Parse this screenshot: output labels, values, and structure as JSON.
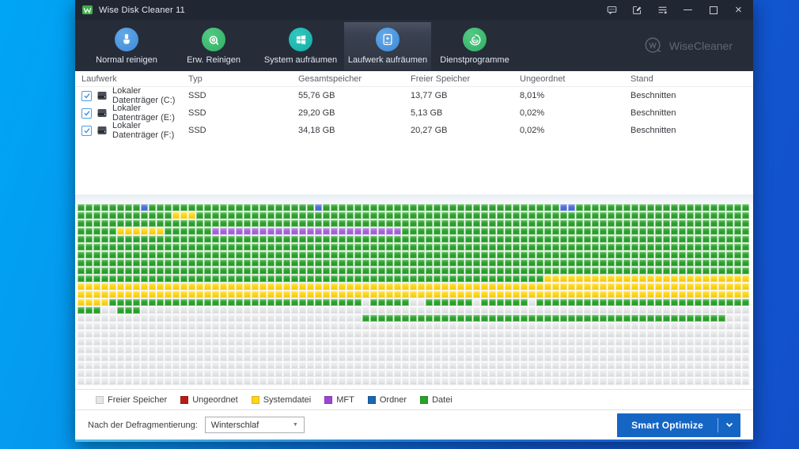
{
  "titlebar": {
    "title": "Wise Disk Cleaner 11"
  },
  "nav": {
    "brand": "WiseCleaner",
    "tabs": [
      {
        "label": "Normal reinigen",
        "selected": false
      },
      {
        "label": "Erw. Reinigen",
        "selected": false
      },
      {
        "label": "System aufräumen",
        "selected": false
      },
      {
        "label": "Laufwerk aufräumen",
        "selected": true
      },
      {
        "label": "Dienstprogramme",
        "selected": false
      }
    ]
  },
  "table": {
    "columns": [
      "Laufwerk",
      "Typ",
      "Gesamtspeicher",
      "Freier Speicher",
      "Ungeordnet",
      "Stand"
    ],
    "rows": [
      {
        "checked": true,
        "name": "Lokaler Datenträger (C:)",
        "typ": "SSD",
        "gesamt": "55,76 GB",
        "frei": "13,77 GB",
        "ungeordnet": "8,01%",
        "stand": "Beschnitten"
      },
      {
        "checked": true,
        "name": "Lokaler Datenträger (E:)",
        "typ": "SSD",
        "gesamt": "29,20 GB",
        "frei": "5,13 GB",
        "ungeordnet": "0,02%",
        "stand": "Beschnitten"
      },
      {
        "checked": true,
        "name": "Lokaler Datenträger (F:)",
        "typ": "SSD",
        "gesamt": "34,18 GB",
        "frei": "20,27 GB",
        "ungeordnet": "0,02%",
        "stand": "Beschnitten"
      }
    ]
  },
  "map": {
    "block_colors": {
      "G": "#2ba32b",
      "Y": "#fed619",
      "P": "#a366d9",
      "B": "#4f6fd6",
      "F": "#e7e8ea",
      "R": "#b51d16"
    },
    "legend": [
      {
        "label": "Freier Speicher",
        "color": "#e4e6e8"
      },
      {
        "label": "Ungeordnet",
        "color": "#b51d16"
      },
      {
        "label": "Systemdatei",
        "color": "#ffd41c"
      },
      {
        "label": "MFT",
        "color": "#9b45d0"
      },
      {
        "label": "Ordner",
        "color": "#1a66b0"
      },
      {
        "label": "Datei",
        "color": "#28a228"
      }
    ],
    "rows": [
      [
        [
          "G",
          8
        ],
        [
          "B",
          1
        ],
        [
          "G",
          21
        ],
        [
          "B",
          1
        ],
        [
          "G",
          30
        ],
        [
          "B",
          2
        ],
        [
          "G",
          22
        ]
      ],
      [
        [
          "G",
          12
        ],
        [
          "Y",
          3
        ],
        [
          "G",
          70
        ]
      ],
      [
        [
          "G",
          85
        ]
      ],
      [
        [
          "G",
          5
        ],
        [
          "Y",
          6
        ],
        [
          "G",
          6
        ],
        [
          "P",
          24
        ],
        [
          "G",
          44
        ]
      ],
      [
        [
          "G",
          85
        ]
      ],
      [
        [
          "G",
          85
        ]
      ],
      [
        [
          "G",
          85
        ]
      ],
      [
        [
          "G",
          85
        ]
      ],
      [
        [
          "G",
          85
        ]
      ],
      [
        [
          "G",
          59
        ],
        [
          "Y",
          26
        ]
      ],
      [
        [
          "Y",
          85
        ]
      ],
      [
        [
          "Y",
          85
        ]
      ],
      [
        [
          "Y",
          4
        ],
        [
          "G",
          32
        ],
        [
          "F",
          1
        ],
        [
          "G",
          5
        ],
        [
          "F",
          2
        ],
        [
          "G",
          6
        ],
        [
          "F",
          1
        ],
        [
          "G",
          6
        ],
        [
          "F",
          1
        ],
        [
          "G",
          27
        ]
      ],
      [
        [
          "G",
          3
        ],
        [
          "F",
          2
        ],
        [
          "G",
          3
        ],
        [
          "F",
          77
        ]
      ],
      [
        [
          "F",
          36
        ],
        [
          "G",
          46
        ],
        [
          "F",
          3
        ]
      ],
      [
        [
          "F",
          85
        ]
      ],
      [
        [
          "F",
          85
        ]
      ],
      [
        [
          "F",
          85
        ]
      ],
      [
        [
          "F",
          85
        ]
      ],
      [
        [
          "F",
          85
        ]
      ],
      [
        [
          "F",
          85
        ]
      ],
      [
        [
          "F",
          85
        ]
      ],
      [
        [
          "F",
          85
        ]
      ]
    ]
  },
  "footer": {
    "label": "Nach der Defragmentierung:",
    "select_value": "Winterschlaf",
    "button_label": "Smart Optimize",
    "button_color": "#1565c4"
  }
}
